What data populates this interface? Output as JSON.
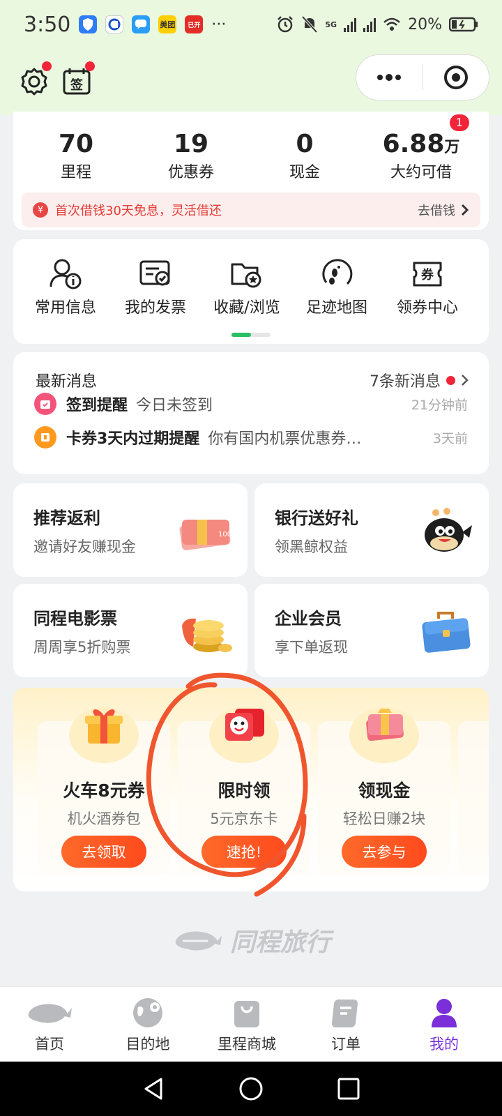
{
  "status_bar": {
    "time": "3:50",
    "app_badges": [
      "美团",
      "已开"
    ],
    "more": "···",
    "network": "5G",
    "battery": "20%"
  },
  "header": {
    "more_icon": "more-dots-icon",
    "record_icon": "target-icon"
  },
  "stats": [
    {
      "value": "70",
      "unit": "",
      "label": "里程"
    },
    {
      "value": "19",
      "unit": "",
      "label": "优惠券"
    },
    {
      "value": "0",
      "unit": "",
      "label": "现金"
    },
    {
      "value": "6.88",
      "unit": "万",
      "label": "大约可借",
      "badge": "1"
    }
  ],
  "loan": {
    "icon": "¥",
    "text": "首次借钱30天免息，灵活借还",
    "action": "去借钱"
  },
  "tools": [
    {
      "label": "常用信息",
      "icon": "user-info-icon"
    },
    {
      "label": "我的发票",
      "icon": "invoice-icon"
    },
    {
      "label": "收藏/浏览",
      "icon": "favorites-icon"
    },
    {
      "label": "足迹地图",
      "icon": "footprint-icon"
    },
    {
      "label": "领券中心",
      "icon": "coupon-icon",
      "glyph": "券"
    }
  ],
  "messages": {
    "title": "最新消息",
    "count": "7条新消息",
    "items": [
      {
        "title": "签到提醒",
        "text": "今日未签到",
        "time": "21分钟前",
        "color": "#f4537a"
      },
      {
        "title": "卡券3天内过期提醒",
        "text": "你有国内机票优惠券…",
        "time": "3天前",
        "color": "#ff9a1f"
      }
    ]
  },
  "promos": [
    {
      "title": "推荐返利",
      "subtitle": "邀请好友赚现金"
    },
    {
      "title": "银行送好礼",
      "subtitle": "领黑鲸权益"
    },
    {
      "title": "同程电影票",
      "subtitle": "周周享5折购票"
    },
    {
      "title": "企业会员",
      "subtitle": "享下单返现"
    }
  ],
  "bonus": [
    {
      "title": "火车8元券",
      "subtitle": "机火酒券包",
      "button": "去领取"
    },
    {
      "title": "限时领",
      "subtitle": "5元京东卡",
      "button": "速抢!"
    },
    {
      "title": "领现金",
      "subtitle": "轻松日赚2块",
      "button": "去参与"
    }
  ],
  "brand": "同程旅行",
  "tabs": [
    {
      "label": "首页",
      "icon": "whale-home-icon"
    },
    {
      "label": "目的地",
      "icon": "globe-icon"
    },
    {
      "label": "里程商城",
      "icon": "shopping-bag-icon"
    },
    {
      "label": "订单",
      "icon": "order-icon"
    },
    {
      "label": "我的",
      "icon": "profile-icon",
      "active": true
    }
  ],
  "colors": {
    "accent_green": "#26c063",
    "accent_purple": "#7a2fd8",
    "alert_red": "#f2243a",
    "button_orange": "#ff5a24",
    "annotation_circle": "#f0562e"
  }
}
